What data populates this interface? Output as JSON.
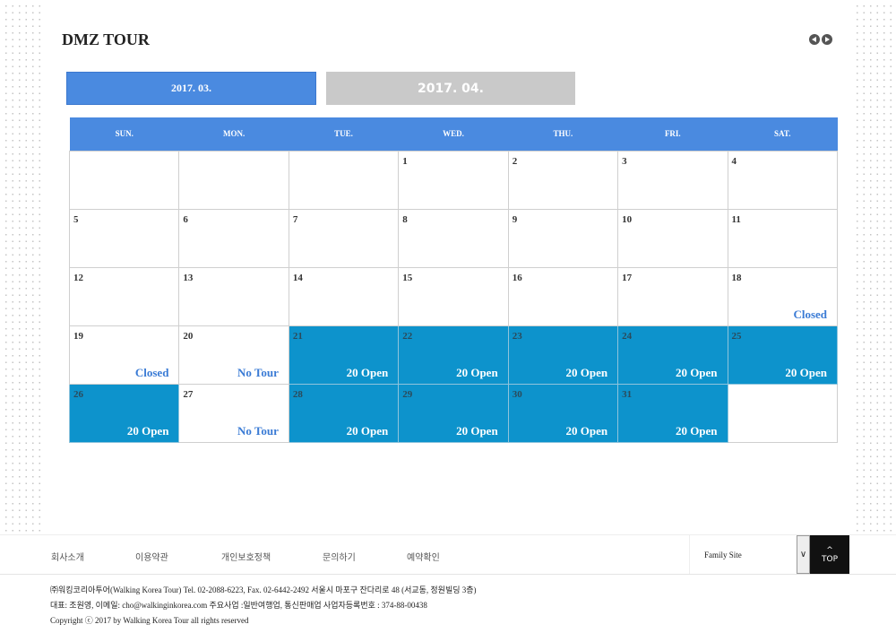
{
  "title": "DMZ TOUR",
  "months": [
    "2017. 03.",
    "2017. 04."
  ],
  "weekdays": [
    "SUN.",
    "MON.",
    "TUE.",
    "WED.",
    "THU.",
    "FRI.",
    "SAT."
  ],
  "weeks": [
    [
      null,
      null,
      null,
      {
        "d": "1"
      },
      {
        "d": "2"
      },
      {
        "d": "3"
      },
      {
        "d": "4"
      }
    ],
    [
      {
        "d": "5"
      },
      {
        "d": "6"
      },
      {
        "d": "7"
      },
      {
        "d": "8"
      },
      {
        "d": "9"
      },
      {
        "d": "10"
      },
      {
        "d": "11"
      }
    ],
    [
      {
        "d": "12"
      },
      {
        "d": "13"
      },
      {
        "d": "14"
      },
      {
        "d": "15"
      },
      {
        "d": "16"
      },
      {
        "d": "17"
      },
      {
        "d": "18",
        "s": "Closed"
      }
    ],
    [
      {
        "d": "19",
        "s": "Closed"
      },
      {
        "d": "20",
        "s": "No Tour"
      },
      {
        "d": "21",
        "s": "20 Open",
        "open": true
      },
      {
        "d": "22",
        "s": "20 Open",
        "open": true
      },
      {
        "d": "23",
        "s": "20 Open",
        "open": true
      },
      {
        "d": "24",
        "s": "20 Open",
        "open": true
      },
      {
        "d": "25",
        "s": "20 Open",
        "open": true
      }
    ],
    [
      {
        "d": "26",
        "s": "20 Open",
        "open": true
      },
      {
        "d": "27",
        "s": "No Tour"
      },
      {
        "d": "28",
        "s": "20 Open",
        "open": true
      },
      {
        "d": "29",
        "s": "20 Open",
        "open": true
      },
      {
        "d": "30",
        "s": "20 Open",
        "open": true
      },
      {
        "d": "31",
        "s": "20 Open",
        "open": true
      },
      null
    ]
  ],
  "footer": {
    "nav": [
      "회사소개",
      "이용약관",
      "개인보호정책",
      "문의하기",
      "예약확인"
    ],
    "family_site": "Family Site",
    "top_label": "TOP",
    "line1": "㈜워킹코리아투어(Walking Korea Tour) Tel. 02-2088-6223, Fax. 02-6442-2492 서울시 마포구 잔다리로 48 (서교동, 정원빌딩 3층)",
    "line2": "대표: 조원영, 이메일: cho@walkinginkorea.com 주요사업 :일반여행업, 통신판매업 사업자등록번호 : 374-88-00438",
    "copyright": "Copyright ⓒ 2017 by Walking Korea Tour all rights reserved"
  },
  "colors": {
    "header": "#4a8ae0",
    "open": "#0d93cc",
    "status_text": "#3a7bd5"
  }
}
